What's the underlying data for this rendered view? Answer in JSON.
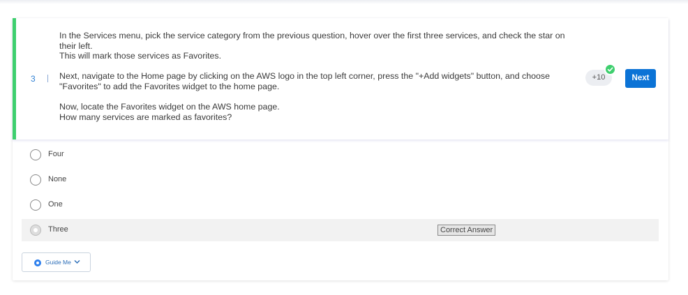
{
  "question": {
    "number": "3",
    "paragraphs": [
      "In the Services menu, pick the service category from the previous question, hover over the first three services, and check the star on their left.\nThis will mark those services as Favorites.",
      "Next, navigate to the Home page by clicking on the AWS logo in the top left corner, press the \"+Add widgets\" button, and choose \"Favorites\" to add the Favorites widget to the home page.",
      "Now, locate the Favorites widget on the AWS home page.\nHow many services are marked as favorites?"
    ],
    "points": "+10",
    "next_label": "Next"
  },
  "options": [
    {
      "label": "Four",
      "selected": false
    },
    {
      "label": "None",
      "selected": false
    },
    {
      "label": "One",
      "selected": false
    },
    {
      "label": "Three",
      "selected": true
    }
  ],
  "correct_answer_label": "Correct Answer",
  "guide_label": "Guide Me",
  "colors": {
    "accent": "#3ecf6e",
    "button": "#0b73d6",
    "number": "#2d7fd3"
  }
}
